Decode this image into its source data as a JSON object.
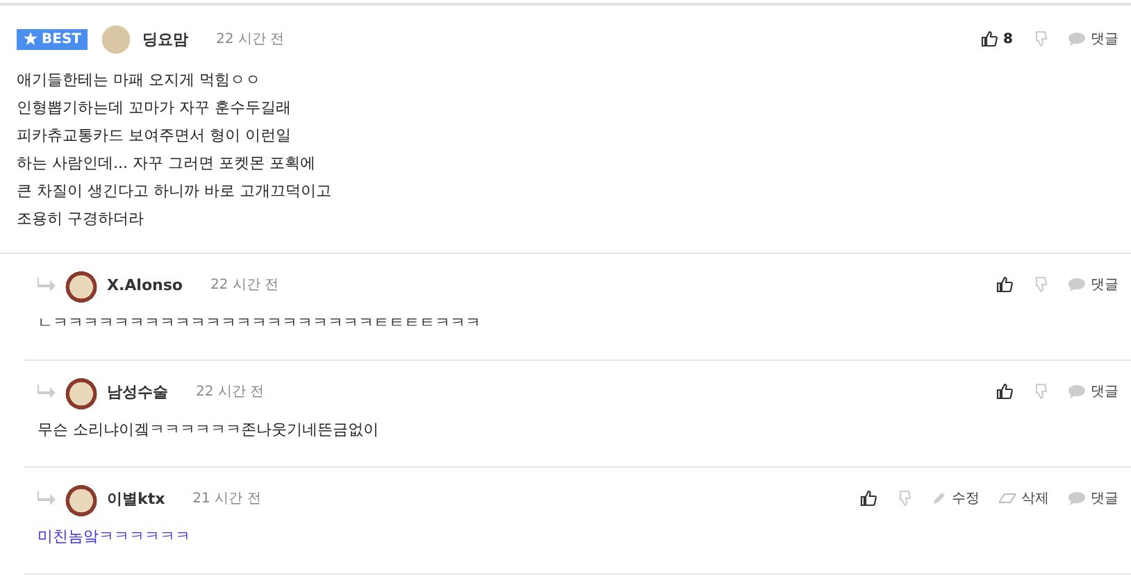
{
  "comments": [
    {
      "kind": "best",
      "badge": "BEST",
      "author": "딩요맘",
      "time": "22 시간 전",
      "likes": "8",
      "body": [
        "애기들한테는 마패 오지게 먹힘ㅇㅇ",
        "인형뽑기하는데 꼬마가 자꾸 훈수두길래",
        "피카츄교통카드 보여주면서 형이 이런일",
        "하는 사람인데... 자꾸 그러면 포켓몬 포획에",
        "큰 차질이 생긴다고 하니까 바로 고개끄덕이고",
        "조용히 구경하더라"
      ],
      "color": "#222222",
      "actions": [
        {
          "kind": "reply",
          "label": "댓글"
        }
      ]
    },
    {
      "kind": "reply",
      "author": "X.Alonso",
      "time": "22 시간 전",
      "body": [
        "ㄴㅋㅋㅋㅋㅋㅋㅋㅋㅋㅋㅋㅋㅋㅋㅋㅋㅋㅋㅋㅋㅋㅌㅌㅌㅌㅋㅋㅋ"
      ],
      "color": "#222222",
      "actions": [
        {
          "kind": "reply",
          "label": "댓글"
        }
      ]
    },
    {
      "kind": "reply",
      "author": "남성수술",
      "time": "22 시간 전",
      "body": [
        "무슨 소리냐이겤ㅋㅋㅋㅋㅋㅋ존나웃기네뜬금없이"
      ],
      "color": "#222222",
      "actions": [
        {
          "kind": "reply",
          "label": "댓글"
        }
      ]
    },
    {
      "kind": "reply",
      "author": "이별ktx",
      "time": "21 시간 전",
      "body": [
        "미친놈앜ㅋㅋㅋㅋㅋㅋ"
      ],
      "color": "#3a2ee0",
      "actions": [
        {
          "kind": "edit",
          "label": "수정"
        },
        {
          "kind": "delete",
          "label": "삭제"
        },
        {
          "kind": "reply",
          "label": "댓글"
        }
      ]
    }
  ]
}
